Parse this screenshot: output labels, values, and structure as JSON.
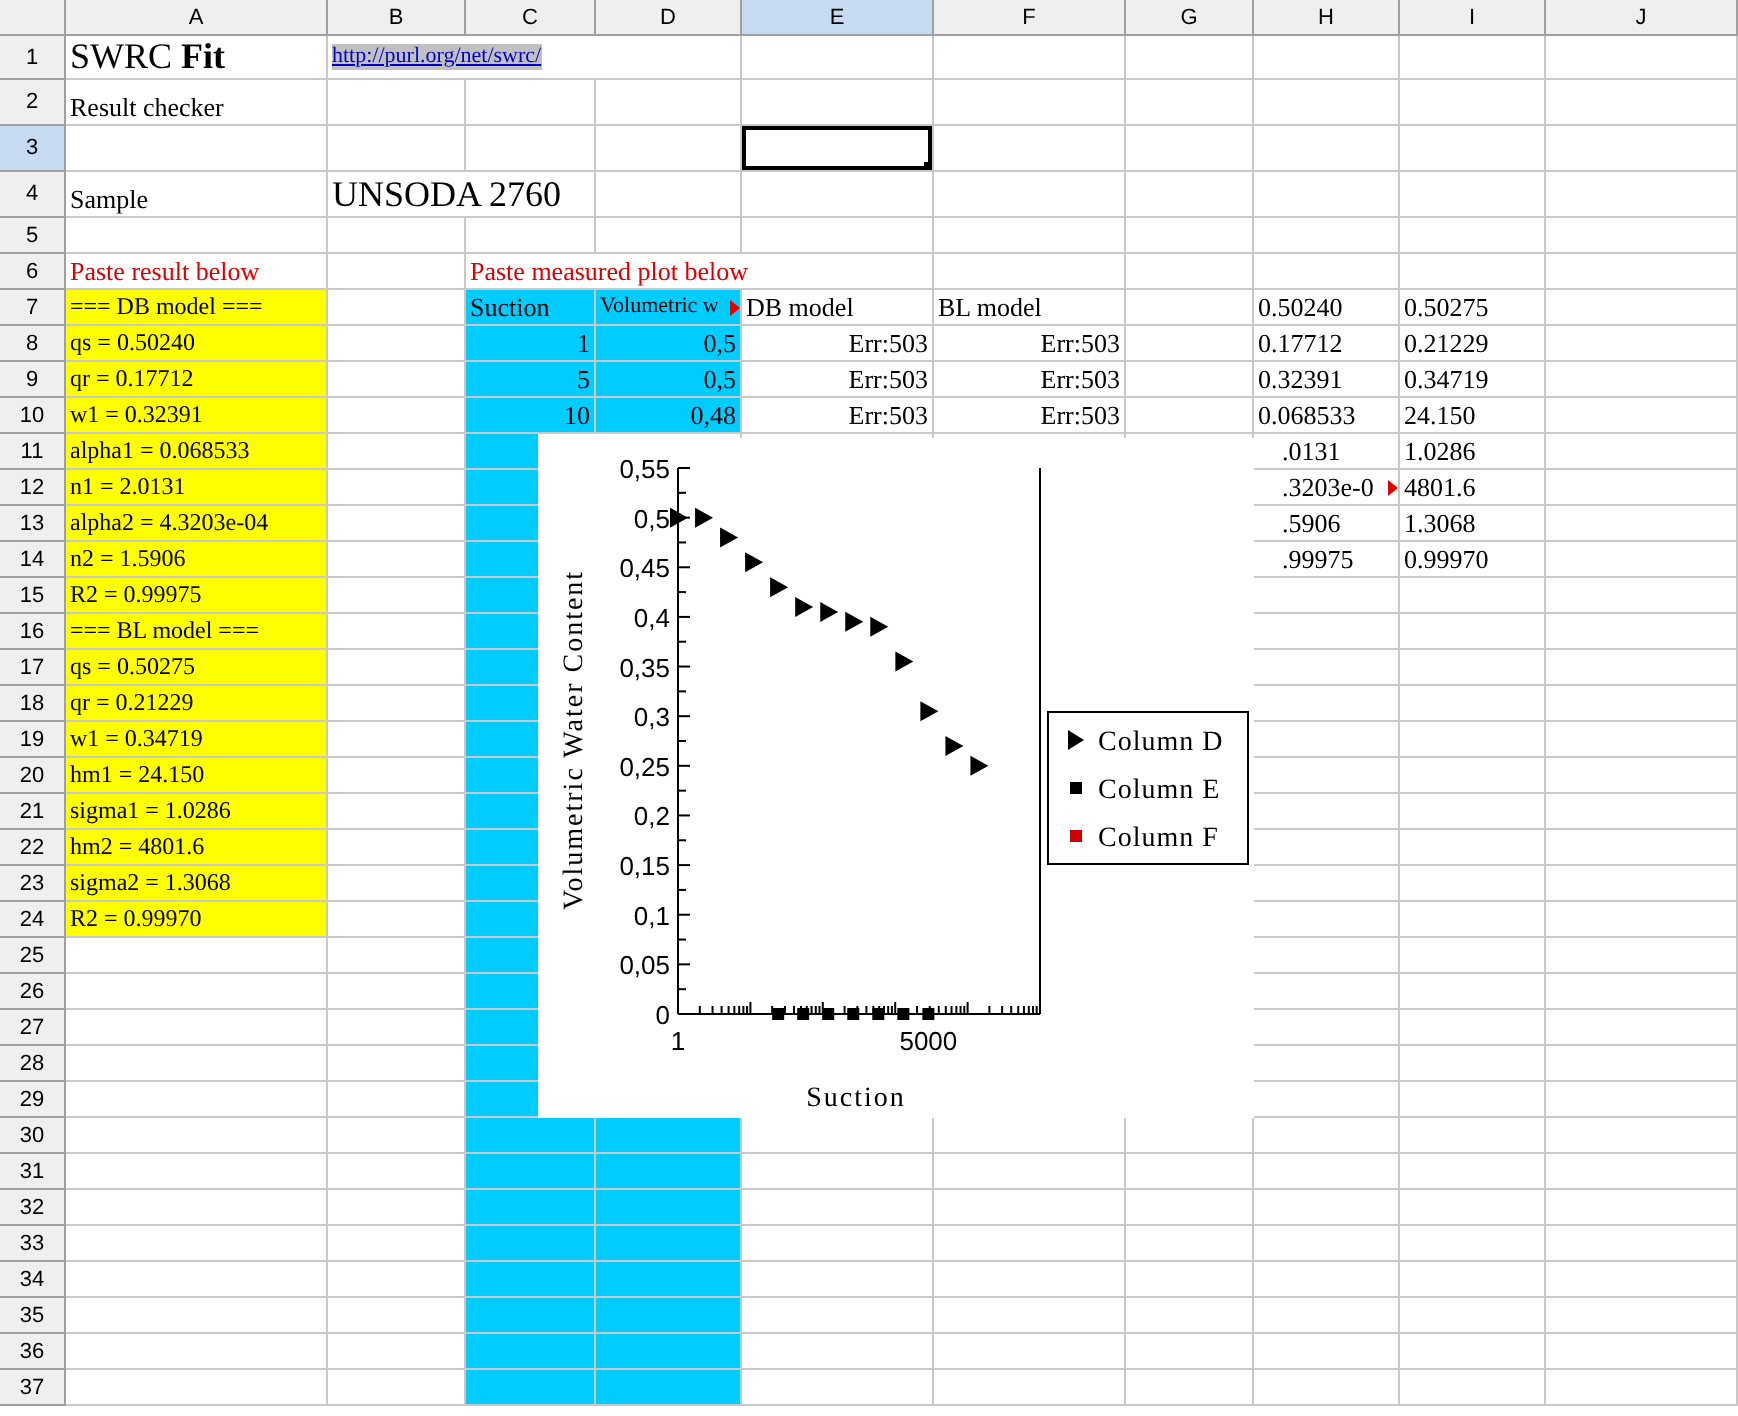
{
  "sheet": {
    "columns": [
      {
        "label": "A",
        "selected": false
      },
      {
        "label": "B",
        "selected": false
      },
      {
        "label": "C",
        "selected": false
      },
      {
        "label": "D",
        "selected": false
      },
      {
        "label": "E",
        "selected": true
      },
      {
        "label": "F",
        "selected": false
      },
      {
        "label": "G",
        "selected": false
      },
      {
        "label": "H",
        "selected": false
      },
      {
        "label": "I",
        "selected": false
      },
      {
        "label": "J",
        "selected": false
      }
    ],
    "rows": [
      {
        "number": "1",
        "selected": false,
        "cells": {
          "A": {
            "kind": "title",
            "text": "SWRC **Fit**"
          },
          "B": {
            "kind": "link",
            "text": "http://purl.org/net/swrc/"
          }
        }
      },
      {
        "number": "2",
        "selected": false,
        "cells": {
          "A": {
            "kind": "text",
            "text": "Result checker"
          }
        }
      },
      {
        "number": "3",
        "selected": true,
        "cells": {}
      },
      {
        "number": "4",
        "selected": false,
        "cells": {
          "A": {
            "kind": "text",
            "text": "Sample"
          },
          "B": {
            "kind": "large",
            "text": "UNSODA 2760"
          }
        }
      },
      {
        "number": "5",
        "selected": false,
        "cells": {}
      },
      {
        "number": "6",
        "selected": false,
        "cells": {
          "A": {
            "kind": "note",
            "text": "Paste result below"
          },
          "C": {
            "kind": "note",
            "text": "Paste measured plot below"
          }
        }
      },
      {
        "number": "7",
        "selected": false,
        "cells": {
          "A": {
            "kind": "param",
            "text": "=== DB model ==="
          },
          "C": {
            "kind": "series",
            "text": "Suction"
          },
          "D": {
            "kind": "series-small",
            "text": "Volumetric w",
            "overflow": true
          },
          "E": {
            "kind": "text",
            "text": "DB model"
          },
          "F": {
            "kind": "text",
            "text": "BL model"
          },
          "H": {
            "kind": "text",
            "text": "0.50240"
          },
          "I": {
            "kind": "text",
            "text": "0.50275"
          }
        }
      },
      {
        "number": "8",
        "selected": false,
        "cells": {
          "A": {
            "kind": "param",
            "text": "qs = 0.50240"
          },
          "C": {
            "kind": "series-number",
            "text": "1"
          },
          "D": {
            "kind": "series-number",
            "text": "0,5"
          },
          "E": {
            "kind": "number",
            "text": "Err:503"
          },
          "F": {
            "kind": "number",
            "text": "Err:503"
          },
          "H": {
            "kind": "text",
            "text": "0.17712"
          },
          "I": {
            "kind": "text",
            "text": "0.21229"
          }
        }
      },
      {
        "number": "9",
        "selected": false,
        "cells": {
          "A": {
            "kind": "param",
            "text": "qr = 0.17712"
          },
          "C": {
            "kind": "series-number",
            "text": "5"
          },
          "D": {
            "kind": "series-number",
            "text": "0,5"
          },
          "E": {
            "kind": "number",
            "text": "Err:503"
          },
          "F": {
            "kind": "number",
            "text": "Err:503"
          },
          "H": {
            "kind": "text",
            "text": "0.32391"
          },
          "I": {
            "kind": "text",
            "text": "0.34719"
          }
        }
      },
      {
        "number": "10",
        "selected": false,
        "cells": {
          "A": {
            "kind": "param",
            "text": "w1 = 0.32391"
          },
          "C": {
            "kind": "series-number",
            "text": "10"
          },
          "D": {
            "kind": "series-number",
            "text": "0,48"
          },
          "E": {
            "kind": "number",
            "text": "Err:503"
          },
          "F": {
            "kind": "number",
            "text": "Err:503"
          },
          "H": {
            "kind": "text",
            "text": "0.068533"
          },
          "I": {
            "kind": "text",
            "text": "24.150"
          }
        }
      },
      {
        "number": "11",
        "selected": false,
        "cells": {
          "A": {
            "kind": "param",
            "text": "alpha1 = 0.068533"
          },
          "C": {
            "kind": "series"
          },
          "H": {
            "kind": "partial",
            "text": ".0131"
          },
          "I": {
            "kind": "text",
            "text": "1.0286"
          }
        }
      },
      {
        "number": "12",
        "selected": false,
        "cells": {
          "A": {
            "kind": "param",
            "text": "n1 = 2.0131"
          },
          "C": {
            "kind": "series"
          },
          "H": {
            "kind": "partial",
            "text": ".3203e-0",
            "overflow": true
          },
          "I": {
            "kind": "text",
            "text": "4801.6"
          }
        }
      },
      {
        "number": "13",
        "selected": false,
        "cells": {
          "A": {
            "kind": "param",
            "text": "alpha2 = 4.3203e-04"
          },
          "C": {
            "kind": "series"
          },
          "H": {
            "kind": "partial",
            "text": ".5906"
          },
          "I": {
            "kind": "text",
            "text": "1.3068"
          }
        }
      },
      {
        "number": "14",
        "selected": false,
        "cells": {
          "A": {
            "kind": "param",
            "text": "n2 = 1.5906"
          },
          "C": {
            "kind": "series"
          },
          "H": {
            "kind": "partial",
            "text": ".99975"
          },
          "I": {
            "kind": "text",
            "text": "0.99970"
          }
        }
      },
      {
        "number": "15",
        "selected": false,
        "cells": {
          "A": {
            "kind": "param",
            "text": "R2 = 0.99975"
          },
          "C": {
            "kind": "series"
          }
        }
      },
      {
        "number": "16",
        "selected": false,
        "cells": {
          "A": {
            "kind": "param",
            "text": "=== BL model ==="
          },
          "C": {
            "kind": "series"
          }
        }
      },
      {
        "number": "17",
        "selected": false,
        "cells": {
          "A": {
            "kind": "param",
            "text": "qs = 0.50275"
          },
          "C": {
            "kind": "series"
          }
        }
      },
      {
        "number": "18",
        "selected": false,
        "cells": {
          "A": {
            "kind": "param",
            "text": "qr = 0.21229"
          },
          "C": {
            "kind": "series"
          }
        }
      },
      {
        "number": "19",
        "selected": false,
        "cells": {
          "A": {
            "kind": "param",
            "text": "w1 = 0.34719"
          },
          "C": {
            "kind": "series"
          }
        }
      },
      {
        "number": "20",
        "selected": false,
        "cells": {
          "A": {
            "kind": "param",
            "text": "hm1 = 24.150"
          },
          "C": {
            "kind": "series"
          }
        }
      },
      {
        "number": "21",
        "selected": false,
        "cells": {
          "A": {
            "kind": "param",
            "text": "sigma1 = 1.0286"
          },
          "C": {
            "kind": "series"
          }
        }
      },
      {
        "number": "22",
        "selected": false,
        "cells": {
          "A": {
            "kind": "param",
            "text": "hm2 = 4801.6"
          },
          "C": {
            "kind": "series"
          }
        }
      },
      {
        "number": "23",
        "selected": false,
        "cells": {
          "A": {
            "kind": "param",
            "text": "sigma2 = 1.3068"
          },
          "C": {
            "kind": "series"
          }
        }
      },
      {
        "number": "24",
        "selected": false,
        "cells": {
          "A": {
            "kind": "param",
            "text": "R2 = 0.99970"
          },
          "C": {
            "kind": "series"
          }
        }
      },
      {
        "number": "25",
        "selected": false,
        "cells": {
          "C": {
            "kind": "series"
          }
        }
      },
      {
        "number": "26",
        "selected": false,
        "cells": {
          "C": {
            "kind": "series"
          }
        }
      },
      {
        "number": "27",
        "selected": false,
        "cells": {
          "C": {
            "kind": "series"
          }
        }
      },
      {
        "number": "28",
        "selected": false,
        "cells": {
          "C": {
            "kind": "series"
          }
        }
      },
      {
        "number": "29",
        "selected": false,
        "cells": {
          "C": {
            "kind": "series"
          }
        }
      },
      {
        "number": "30",
        "selected": false,
        "cells": {
          "C": {
            "kind": "series"
          },
          "D": {
            "kind": "series"
          }
        }
      },
      {
        "number": "31",
        "selected": false,
        "cells": {
          "C": {
            "kind": "series"
          },
          "D": {
            "kind": "series"
          }
        }
      },
      {
        "number": "32",
        "selected": false,
        "cells": {
          "C": {
            "kind": "series"
          },
          "D": {
            "kind": "series"
          }
        }
      },
      {
        "number": "33",
        "selected": false,
        "cells": {
          "C": {
            "kind": "series"
          },
          "D": {
            "kind": "series"
          }
        }
      },
      {
        "number": "34",
        "selected": false,
        "cells": {
          "C": {
            "kind": "series"
          },
          "D": {
            "kind": "series"
          }
        }
      },
      {
        "number": "35",
        "selected": false,
        "cells": {
          "C": {
            "kind": "series"
          },
          "D": {
            "kind": "series"
          }
        }
      },
      {
        "number": "36",
        "selected": false,
        "cells": {
          "C": {
            "kind": "series"
          },
          "D": {
            "kind": "series"
          }
        }
      },
      {
        "number": "37",
        "selected": false,
        "cells": {
          "C": {
            "kind": "series"
          },
          "D": {
            "kind": "series"
          }
        }
      }
    ]
  },
  "chart": {
    "chart_data": {
      "type": "scatter",
      "xlabel": "Suction",
      "ylabel": "Volumetric Water Content",
      "categories": [
        "1",
        null,
        null,
        null,
        null,
        null,
        null,
        null,
        null,
        null,
        "5000",
        null,
        null
      ],
      "series": [
        {
          "name": "Column D",
          "color": "#000000",
          "marker": "triangle",
          "values": [
            0.5,
            0.5,
            0.48,
            0.455,
            0.43,
            0.41,
            0.405,
            0.395,
            0.39,
            0.355,
            0.305,
            0.27,
            0.25
          ]
        },
        {
          "name": "Column E",
          "color": "#000000",
          "marker": "square",
          "values": [
            null,
            null,
            null,
            null,
            0,
            0,
            0,
            0,
            0,
            0,
            0,
            null,
            null
          ]
        },
        {
          "name": "Column F",
          "color": "#cc0000",
          "marker": "square",
          "values": [
            null,
            null,
            null,
            null,
            null,
            null,
            null,
            null,
            null,
            null,
            null,
            null,
            null
          ]
        }
      ],
      "legend": "right",
      "ylim": [
        0,
        0.55
      ],
      "yticks": [
        {
          "value": 0,
          "label": "0"
        },
        {
          "value": 0.05,
          "label": "0,05"
        },
        {
          "value": 0.1,
          "label": "0,1"
        },
        {
          "value": 0.15,
          "label": "0,15"
        },
        {
          "value": 0.2,
          "label": "0,2"
        },
        {
          "value": 0.25,
          "label": "0,25"
        },
        {
          "value": 0.3,
          "label": "0,3"
        },
        {
          "value": 0.35,
          "label": "0,35"
        },
        {
          "value": 0.4,
          "label": "0,4"
        },
        {
          "value": 0.45,
          "label": "0,45"
        },
        {
          "value": 0.5,
          "label": "0,5"
        },
        {
          "value": 0.55,
          "label": "0,55"
        }
      ]
    }
  }
}
